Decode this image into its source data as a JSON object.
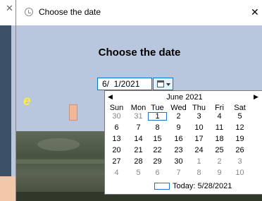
{
  "background_window": {
    "close_icon": "close-icon"
  },
  "dialog": {
    "title": "Choose the date",
    "icon": "clock-icon",
    "close_symbol": "✕",
    "heading": "Choose the date"
  },
  "date_picker": {
    "value": "6/  1/2021",
    "button_icon": "calendar-icon"
  },
  "calendar": {
    "month_title": "June 2021",
    "prev_icon": "◀",
    "next_icon": "▶",
    "weekdays": [
      "Sun",
      "Mon",
      "Tue",
      "Wed",
      "Thu",
      "Fri",
      "Sat"
    ],
    "weeks": [
      [
        {
          "d": "30",
          "o": true
        },
        {
          "d": "31",
          "o": true
        },
        {
          "d": "1",
          "sel": true
        },
        {
          "d": "2"
        },
        {
          "d": "3"
        },
        {
          "d": "4"
        },
        {
          "d": "5"
        }
      ],
      [
        {
          "d": "6"
        },
        {
          "d": "7"
        },
        {
          "d": "8"
        },
        {
          "d": "9"
        },
        {
          "d": "10"
        },
        {
          "d": "11"
        },
        {
          "d": "12"
        }
      ],
      [
        {
          "d": "13"
        },
        {
          "d": "14"
        },
        {
          "d": "15"
        },
        {
          "d": "16"
        },
        {
          "d": "17"
        },
        {
          "d": "18"
        },
        {
          "d": "19"
        }
      ],
      [
        {
          "d": "20"
        },
        {
          "d": "21"
        },
        {
          "d": "22"
        },
        {
          "d": "23"
        },
        {
          "d": "24"
        },
        {
          "d": "25"
        },
        {
          "d": "26"
        }
      ],
      [
        {
          "d": "27"
        },
        {
          "d": "28"
        },
        {
          "d": "29"
        },
        {
          "d": "30"
        },
        {
          "d": "1",
          "o": true
        },
        {
          "d": "2",
          "o": true
        },
        {
          "d": "3",
          "o": true
        }
      ],
      [
        {
          "d": "4",
          "o": true
        },
        {
          "d": "5",
          "o": true
        },
        {
          "d": "6",
          "o": true
        },
        {
          "d": "7",
          "o": true
        },
        {
          "d": "8",
          "o": true
        },
        {
          "d": "9",
          "o": true
        },
        {
          "d": "10",
          "o": true
        }
      ]
    ],
    "today_label": "Today: 5/28/2021"
  },
  "photo_caption_fragment": "e",
  "colors": {
    "client_bg": "#b9c7de",
    "accent": "#0078d7",
    "other_month": "#888888",
    "caption": "#ffee33"
  }
}
